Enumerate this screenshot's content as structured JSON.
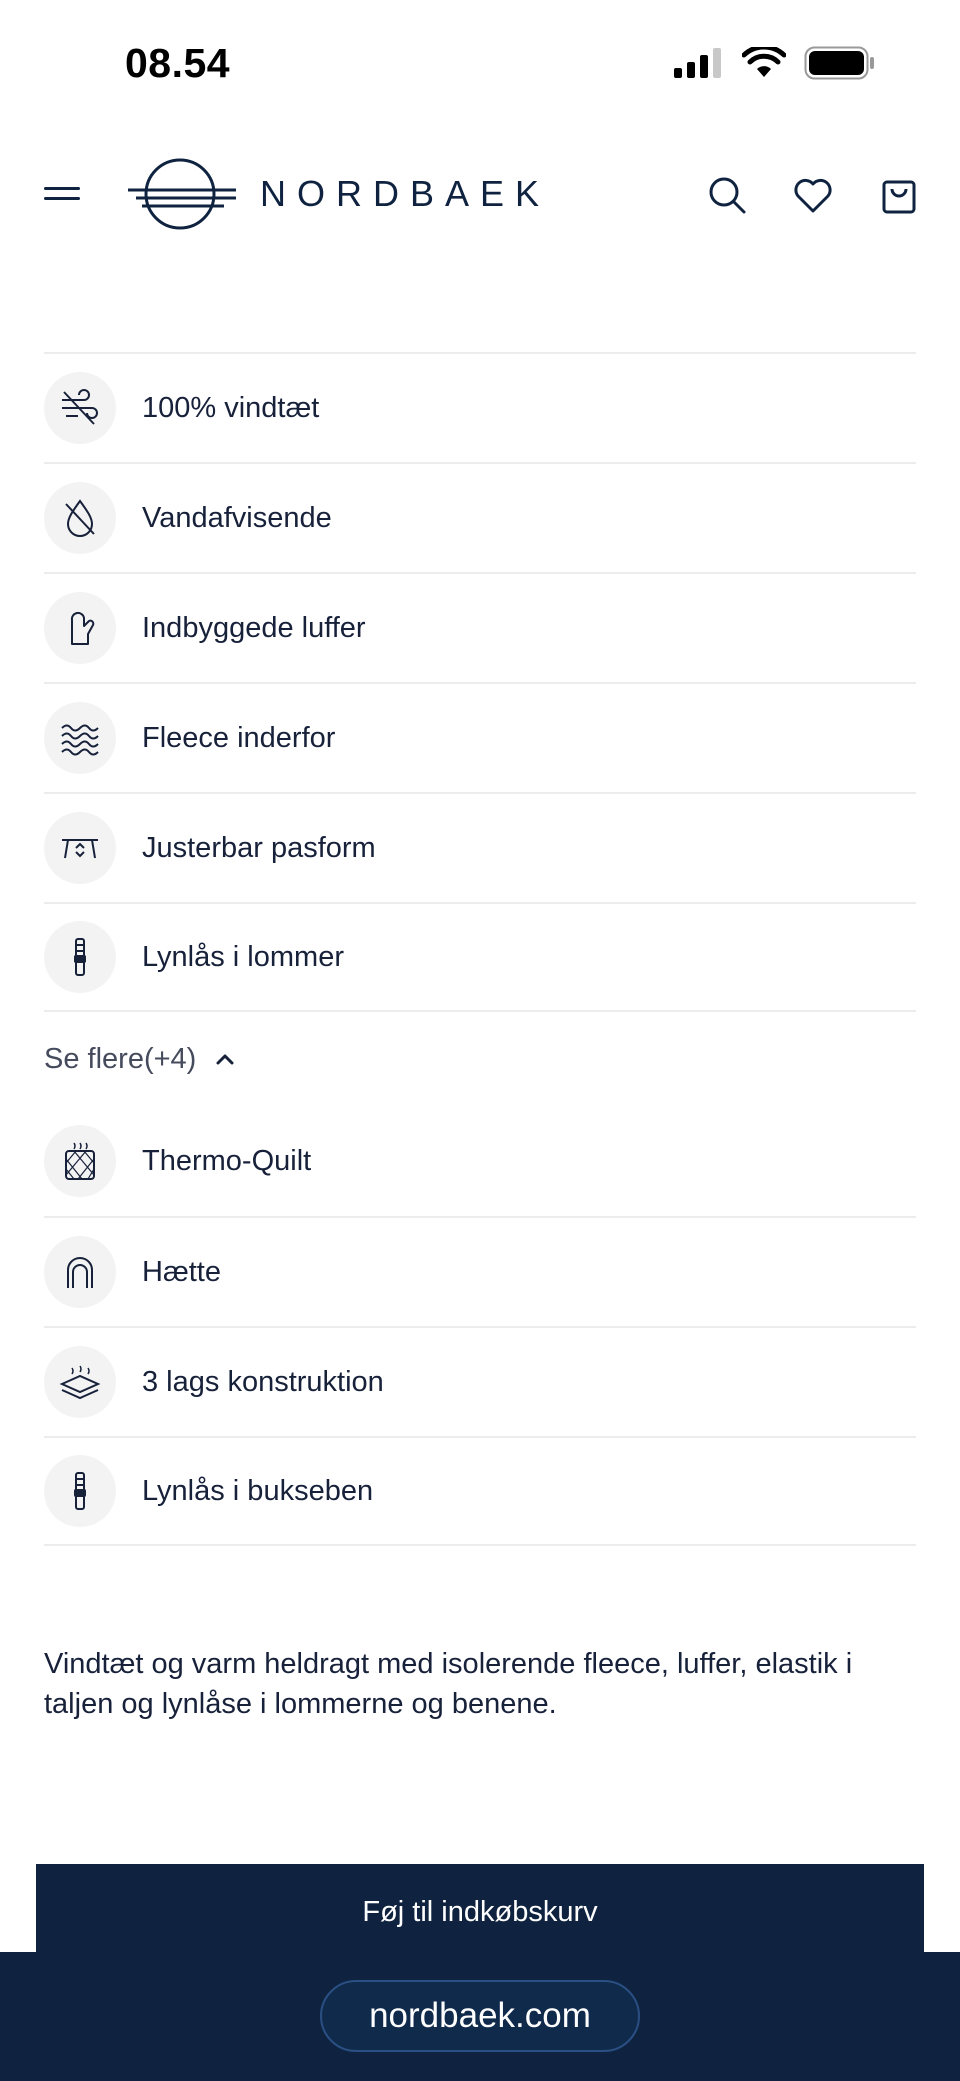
{
  "status_bar": {
    "time": "08.54",
    "icons": [
      "cellular-signal-icon",
      "wifi-icon",
      "battery-icon"
    ]
  },
  "header": {
    "brand": "NORDBAEK",
    "icons": [
      "hamburger-menu-icon",
      "search-icon",
      "heart-icon",
      "shopping-bag-icon"
    ]
  },
  "features": [
    {
      "label": "100% vindtæt",
      "icon": "wind-icon"
    },
    {
      "label": "Vandafvisende",
      "icon": "water-drop-icon"
    },
    {
      "label": "Indbyggede luffer",
      "icon": "mitten-icon"
    },
    {
      "label": "Fleece inderfor",
      "icon": "fleece-waves-icon"
    },
    {
      "label": "Justerbar pasform",
      "icon": "adjustable-fit-icon"
    },
    {
      "label": "Lynlås i lommer",
      "icon": "zipper-icon"
    }
  ],
  "see_more": {
    "label": "Se flere(+4)",
    "icon": "chevron-up-icon"
  },
  "more_features": [
    {
      "label": "Thermo-Quilt",
      "icon": "quilt-icon"
    },
    {
      "label": "Hætte",
      "icon": "hood-icon"
    },
    {
      "label": "3 lags konstruktion",
      "icon": "layers-icon"
    },
    {
      "label": "Lynlås i bukseben",
      "icon": "zipper-icon"
    }
  ],
  "description": "Vindtæt og varm heldragt med isolerende fleece, luffer, elastik i taljen og lynlåse i lommerne og benene.",
  "cart_button": {
    "label": "Føj til indkøbskurv"
  },
  "browser": {
    "url": "nordbaek.com"
  },
  "colors": {
    "brand_navy": "#0f2340",
    "divider": "#ececec",
    "icon_bg": "#f3f3f3"
  }
}
